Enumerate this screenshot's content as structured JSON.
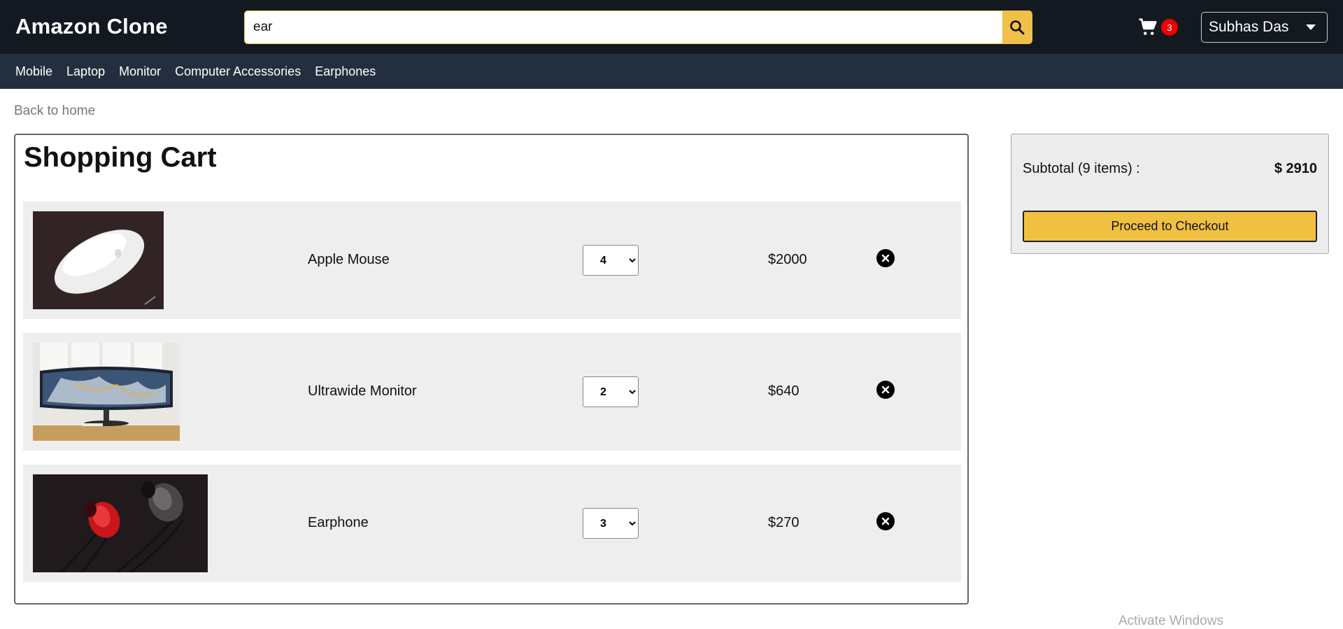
{
  "header": {
    "brand": "Amazon Clone",
    "search": {
      "value": "ear",
      "icon": "search-icon"
    },
    "cart": {
      "icon": "cart-icon",
      "count": "3"
    },
    "user": {
      "name": "Subhas Das"
    }
  },
  "nav": {
    "items": [
      "Mobile",
      "Laptop",
      "Monitor",
      "Computer Accessories",
      "Earphones"
    ]
  },
  "back_link": "Back to home",
  "cart": {
    "title": "Shopping Cart",
    "items": [
      {
        "name": "Apple Mouse",
        "qty": "4",
        "price": "$2000"
      },
      {
        "name": "Ultrawide Monitor",
        "qty": "2",
        "price": "$640"
      },
      {
        "name": "Earphone",
        "qty": "3",
        "price": "$270"
      }
    ]
  },
  "summary": {
    "label": "Subtotal (9 items) :",
    "total": "$ 2910",
    "checkout": "Proceed to Checkout"
  },
  "watermark": "Activate Windows",
  "colors": {
    "header_bg": "#131921",
    "nav_bg": "#232f3e",
    "accent": "#f0c040",
    "badge": "#e00000"
  }
}
